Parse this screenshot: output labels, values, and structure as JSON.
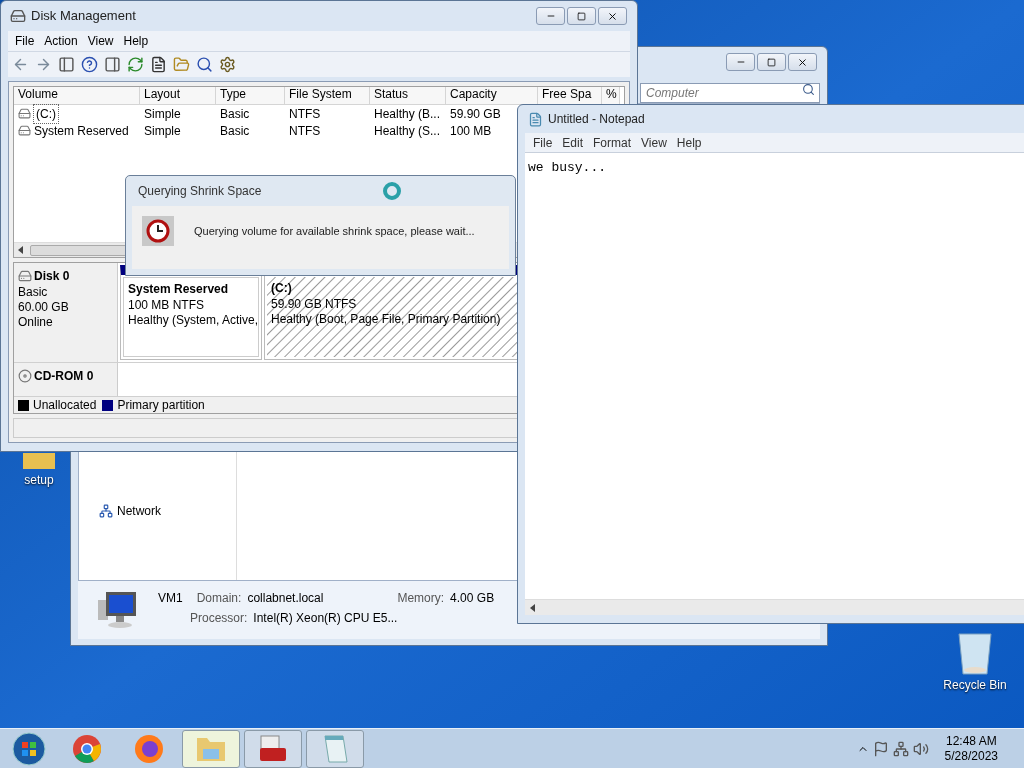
{
  "desktop": {
    "icons": [
      {
        "label": "setup",
        "kind": "folder"
      },
      {
        "label": "Recycle Bin",
        "kind": "recycle-bin"
      }
    ]
  },
  "explorer": {
    "search": {
      "placeholder": "Computer"
    },
    "nav": [
      {
        "label": "Network",
        "kind": "network"
      }
    ],
    "details": {
      "name": "VM1",
      "fields": [
        {
          "label": "Domain:",
          "value": "collabnet.local"
        },
        {
          "label": "Memory:",
          "value": "4.00 GB"
        },
        {
          "label": "Processor:",
          "value": "Intel(R) Xeon(R) CPU E5..."
        }
      ]
    }
  },
  "disk_management": {
    "title": "Disk Management",
    "menu": [
      "File",
      "Action",
      "View",
      "Help"
    ],
    "table": {
      "columns": [
        "Volume",
        "Layout",
        "Type",
        "File System",
        "Status",
        "Capacity",
        "Free Spa",
        "%"
      ],
      "rows": [
        {
          "selected": true,
          "cells": [
            "(C:)",
            "Simple",
            "Basic",
            "NTFS",
            "Healthy (B...",
            "59.90 GB"
          ]
        },
        {
          "selected": false,
          "cells": [
            "System Reserved",
            "Simple",
            "Basic",
            "NTFS",
            "Healthy (S...",
            "100 MB"
          ]
        }
      ]
    },
    "disks": [
      {
        "kind": "disk",
        "name": "Disk 0",
        "lines": [
          "Basic",
          "60.00 GB",
          "Online"
        ],
        "partitions": [
          {
            "name": "System Reserved",
            "size": "100 MB NTFS",
            "status": "Healthy (System, Active,",
            "selected": false
          },
          {
            "name": "(C:)",
            "size": "59.90 GB NTFS",
            "status": "Healthy (Boot, Page File, Primary Partition)",
            "selected": true
          }
        ]
      },
      {
        "kind": "cdrom",
        "name": "CD-ROM 0"
      }
    ],
    "legend": [
      {
        "label": "Unallocated",
        "color": "#000000"
      },
      {
        "label": "Primary partition",
        "color": "#000080"
      }
    ]
  },
  "dialog": {
    "title": "Querying Shrink Space",
    "message": "Querying volume for available shrink space, please wait..."
  },
  "notepad": {
    "title": "Untitled - Notepad",
    "menu": [
      "File",
      "Edit",
      "Format",
      "View",
      "Help"
    ],
    "text": "we busy..."
  },
  "taskbar": {
    "apps": [
      {
        "kind": "start",
        "open": false,
        "selected": false
      },
      {
        "kind": "chrome",
        "open": false,
        "selected": false
      },
      {
        "kind": "firefox",
        "open": false,
        "selected": false
      },
      {
        "kind": "explorer",
        "open": true,
        "selected": true
      },
      {
        "kind": "toolbox",
        "open": true,
        "selected": false
      },
      {
        "kind": "notepad",
        "open": true,
        "selected": false
      }
    ],
    "clock": {
      "time": "12:48 AM",
      "date": "5/28/2023"
    }
  }
}
